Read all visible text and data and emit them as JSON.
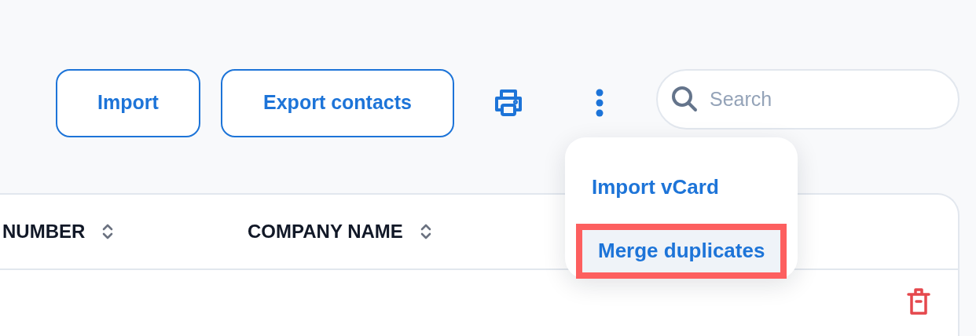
{
  "toolbar": {
    "buttons": [
      "Import",
      "Export contacts"
    ],
    "search": {
      "placeholder": "Search"
    }
  },
  "table": {
    "columns": [
      "NUMBER",
      "COMPANY NAME"
    ]
  },
  "menu": {
    "items": [
      {
        "label": "Import vCard",
        "selected": false
      },
      {
        "label": "Merge duplicates",
        "selected": true
      }
    ]
  }
}
